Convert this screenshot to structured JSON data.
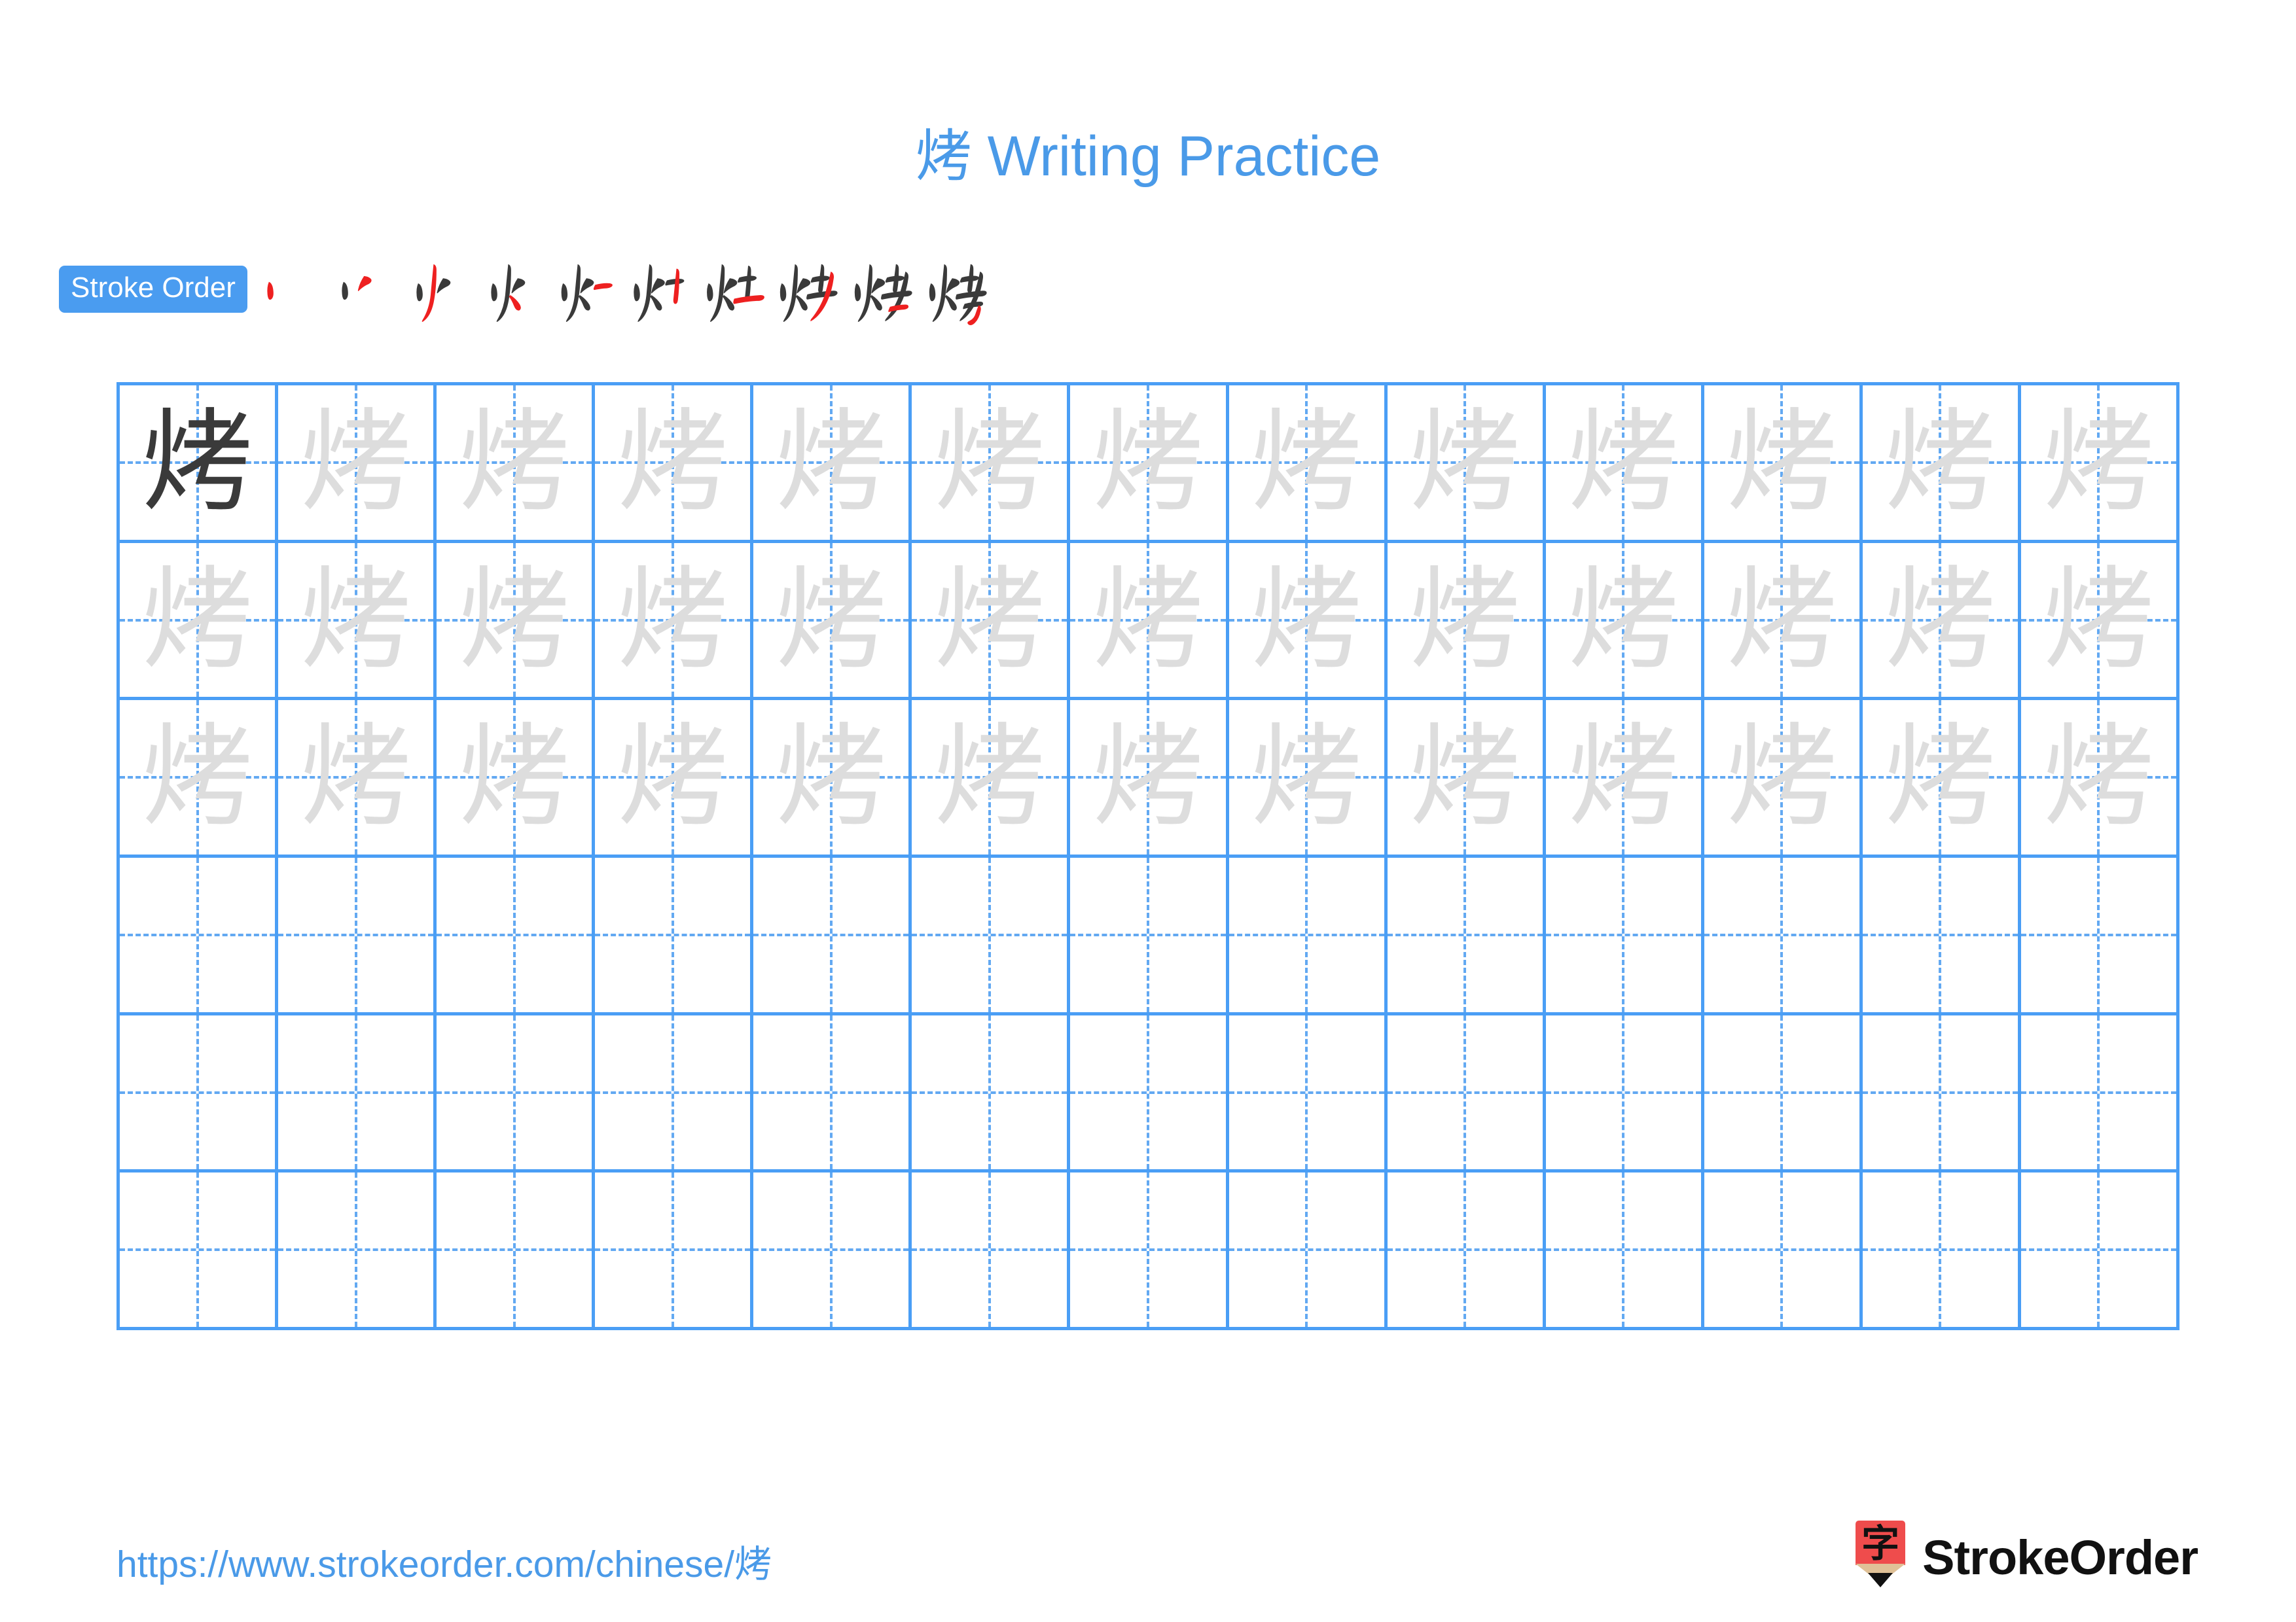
{
  "page": {
    "character": "烤",
    "background_color": "#ffffff",
    "accent_blue": "#4a9ae8",
    "grid_line_color": "#4a9ef5",
    "grid_guide_color": "#63a9f2",
    "stroke_new_color": "#ee2020",
    "stroke_old_color": "#3a3a3a",
    "trace_color": "#dddddd"
  },
  "header": {
    "title": "烤 Writing Practice",
    "title_character": "烤",
    "title_text": " Writing Practice"
  },
  "stroke_order": {
    "badge_label": "Stroke Order",
    "total_strokes": 10,
    "steps": [
      {
        "index": 1,
        "partial": "丶"
      },
      {
        "index": 2,
        "partial": "丷"
      },
      {
        "index": 3,
        "partial": "丿"
      },
      {
        "index": 4,
        "partial": "火"
      },
      {
        "index": 5,
        "partial": "灯"
      },
      {
        "index": 6,
        "partial": "灯"
      },
      {
        "index": 7,
        "partial": "灶"
      },
      {
        "index": 8,
        "partial": "炒"
      },
      {
        "index": 9,
        "partial": "烤"
      },
      {
        "index": 10,
        "partial": "烤"
      }
    ]
  },
  "practice_grid": {
    "columns": 13,
    "rows": 6,
    "row_states": [
      {
        "row": 1,
        "cells": [
          "dark",
          "trace",
          "trace",
          "trace",
          "trace",
          "trace",
          "trace",
          "trace",
          "trace",
          "trace",
          "trace",
          "trace",
          "trace"
        ]
      },
      {
        "row": 2,
        "cells": [
          "trace",
          "trace",
          "trace",
          "trace",
          "trace",
          "trace",
          "trace",
          "trace",
          "trace",
          "trace",
          "trace",
          "trace",
          "trace"
        ]
      },
      {
        "row": 3,
        "cells": [
          "trace",
          "trace",
          "trace",
          "trace",
          "trace",
          "trace",
          "trace",
          "trace",
          "trace",
          "trace",
          "trace",
          "trace",
          "trace"
        ]
      },
      {
        "row": 4,
        "cells": [
          "empty",
          "empty",
          "empty",
          "empty",
          "empty",
          "empty",
          "empty",
          "empty",
          "empty",
          "empty",
          "empty",
          "empty",
          "empty"
        ]
      },
      {
        "row": 5,
        "cells": [
          "empty",
          "empty",
          "empty",
          "empty",
          "empty",
          "empty",
          "empty",
          "empty",
          "empty",
          "empty",
          "empty",
          "empty",
          "empty"
        ]
      },
      {
        "row": 6,
        "cells": [
          "empty",
          "empty",
          "empty",
          "empty",
          "empty",
          "empty",
          "empty",
          "empty",
          "empty",
          "empty",
          "empty",
          "empty",
          "empty"
        ]
      }
    ]
  },
  "footer": {
    "url_prefix": "https://www.strokeorder.com/chinese/",
    "url_character": "烤",
    "url": "https://www.strokeorder.com/chinese/烤",
    "brand_name": "StrokeOrder",
    "brand_icon_glyph": "字",
    "brand_icon_color": "#ef4c4c"
  }
}
